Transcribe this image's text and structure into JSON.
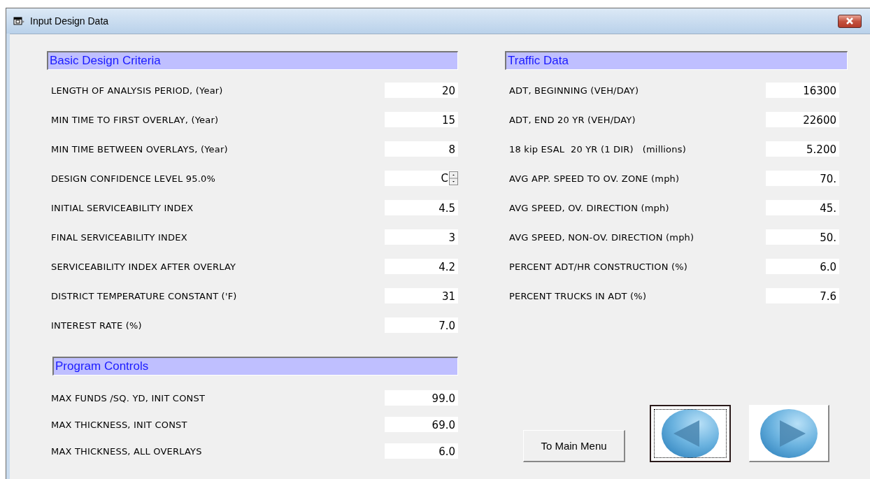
{
  "window": {
    "title": "Input Design Data"
  },
  "basic_design_criteria": {
    "heading": "Basic Design Criteria",
    "rows": [
      {
        "label": "LENGTH OF ANALYSIS PERIOD, (Year)",
        "value": "20",
        "kind": "text"
      },
      {
        "label": "MIN TIME TO FIRST OVERLAY, (Year)",
        "value": "15",
        "kind": "text"
      },
      {
        "label": "MIN TIME BETWEEN OVERLAYS, (Year)",
        "value": "8",
        "kind": "text"
      },
      {
        "label": "DESIGN CONFIDENCE LEVEL 95.0%",
        "value": "C",
        "kind": "spin"
      },
      {
        "label": "INITIAL SERVICEABILITY INDEX",
        "value": "4.5",
        "kind": "text"
      },
      {
        "label": "FINAL SERVICEABILITY INDEX",
        "value": "3",
        "kind": "text"
      },
      {
        "label": "SERVICEABILITY INDEX AFTER OVERLAY",
        "value": "4.2",
        "kind": "text"
      },
      {
        "label": "DISTRICT TEMPERATURE CONSTANT ('F)",
        "value": "31",
        "kind": "text"
      },
      {
        "label": "INTEREST RATE (%)",
        "value": "7.0",
        "kind": "text"
      }
    ]
  },
  "program_controls": {
    "heading": "Program Controls",
    "rows": [
      {
        "label": "MAX FUNDS /SQ. YD, INIT CONST",
        "value": "99.0"
      },
      {
        "label": "MAX THICKNESS, INIT CONST",
        "value": "69.0"
      },
      {
        "label": "MAX THICKNESS, ALL OVERLAYS",
        "value": "6.0"
      }
    ]
  },
  "traffic_data": {
    "heading": "Traffic Data",
    "rows": [
      {
        "label": "ADT, BEGINNING (VEH/DAY)",
        "value": "16300",
        "kind": "text"
      },
      {
        "label": "ADT, END 20 YR (VEH/DAY)",
        "value": "22600",
        "kind": "text"
      },
      {
        "label": "18 kip ESAL  20 YR (1 DIR)   (millions)",
        "value": "5.200",
        "kind": "text"
      },
      {
        "label": "AVG APP. SPEED TO OV. ZONE (mph)",
        "value": "70.",
        "kind": "text"
      },
      {
        "label": "AVG SPEED, OV. DIRECTION (mph)",
        "value": "45.",
        "kind": "text"
      },
      {
        "label": "AVG SPEED, NON-OV. DIRECTION (mph)",
        "value": "50.",
        "kind": "text"
      },
      {
        "label": "PERCENT ADT/HR CONSTRUCTION (%)",
        "value": "6.0",
        "kind": "text"
      },
      {
        "label": "PERCENT TRUCKS IN ADT (%)",
        "value": "7.6",
        "kind": "text"
      }
    ]
  },
  "buttons": {
    "main_menu": "To Main Menu",
    "nav": [
      {
        "kind": "previous",
        "focused": true
      },
      {
        "kind": "next",
        "focused": false
      }
    ]
  }
}
